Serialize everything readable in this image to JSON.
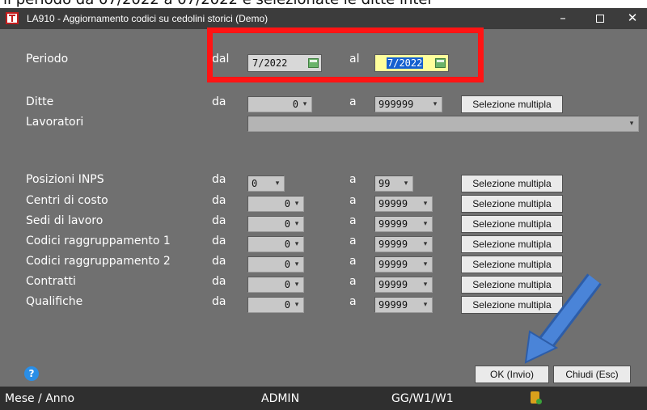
{
  "doc_strip_text": "il periodo da 07/2022 a 07/2022 e selezionate le ditte inter",
  "window": {
    "title": "LA910 - Aggiornamento codici su cedolini storici (Demo)",
    "minimize": "–",
    "close": "✕"
  },
  "periodo": {
    "label": "Periodo",
    "dal_label": "dal",
    "dal_value": "7/2022",
    "al_label": "al",
    "al_value": "7/2022"
  },
  "ditte": {
    "label": "Ditte",
    "da_label": "da",
    "from": "0",
    "a_label": "a",
    "to": "999999",
    "button": "Selezione multipla"
  },
  "lavoratori": {
    "label": "Lavoratori"
  },
  "rows": [
    {
      "label": "Posizioni INPS",
      "da": "da",
      "from": "0",
      "a": "a",
      "to": "99",
      "button": "Selezione multipla"
    },
    {
      "label": "Centri di costo",
      "da": "da",
      "from": "0",
      "a": "a",
      "to": "99999",
      "button": "Selezione multipla"
    },
    {
      "label": "Sedi di lavoro",
      "da": "da",
      "from": "0",
      "a": "a",
      "to": "99999",
      "button": "Selezione multipla"
    },
    {
      "label": "Codici raggruppamento 1",
      "da": "da",
      "from": "0",
      "a": "a",
      "to": "99999",
      "button": "Selezione multipla"
    },
    {
      "label": "Codici raggruppamento 2",
      "da": "da",
      "from": "0",
      "a": "a",
      "to": "99999",
      "button": "Selezione multipla"
    },
    {
      "label": "Contratti",
      "da": "da",
      "from": "0",
      "a": "a",
      "to": "99999",
      "button": "Selezione multipla"
    },
    {
      "label": "Qualifiche",
      "da": "da",
      "from": "0",
      "a": "a",
      "to": "99999",
      "button": "Selezione multipla"
    }
  ],
  "footer": {
    "help": "?",
    "ok_button": "OK (Invio)",
    "close_button": "Chiudi (Esc)"
  },
  "statusbar": {
    "left": "Mese / Anno",
    "user": "ADMIN",
    "code": "GG/W1/W1"
  },
  "colors": {
    "highlight": "#ff1414",
    "arrow": "#3b73c8",
    "window_bg": "#707070"
  }
}
